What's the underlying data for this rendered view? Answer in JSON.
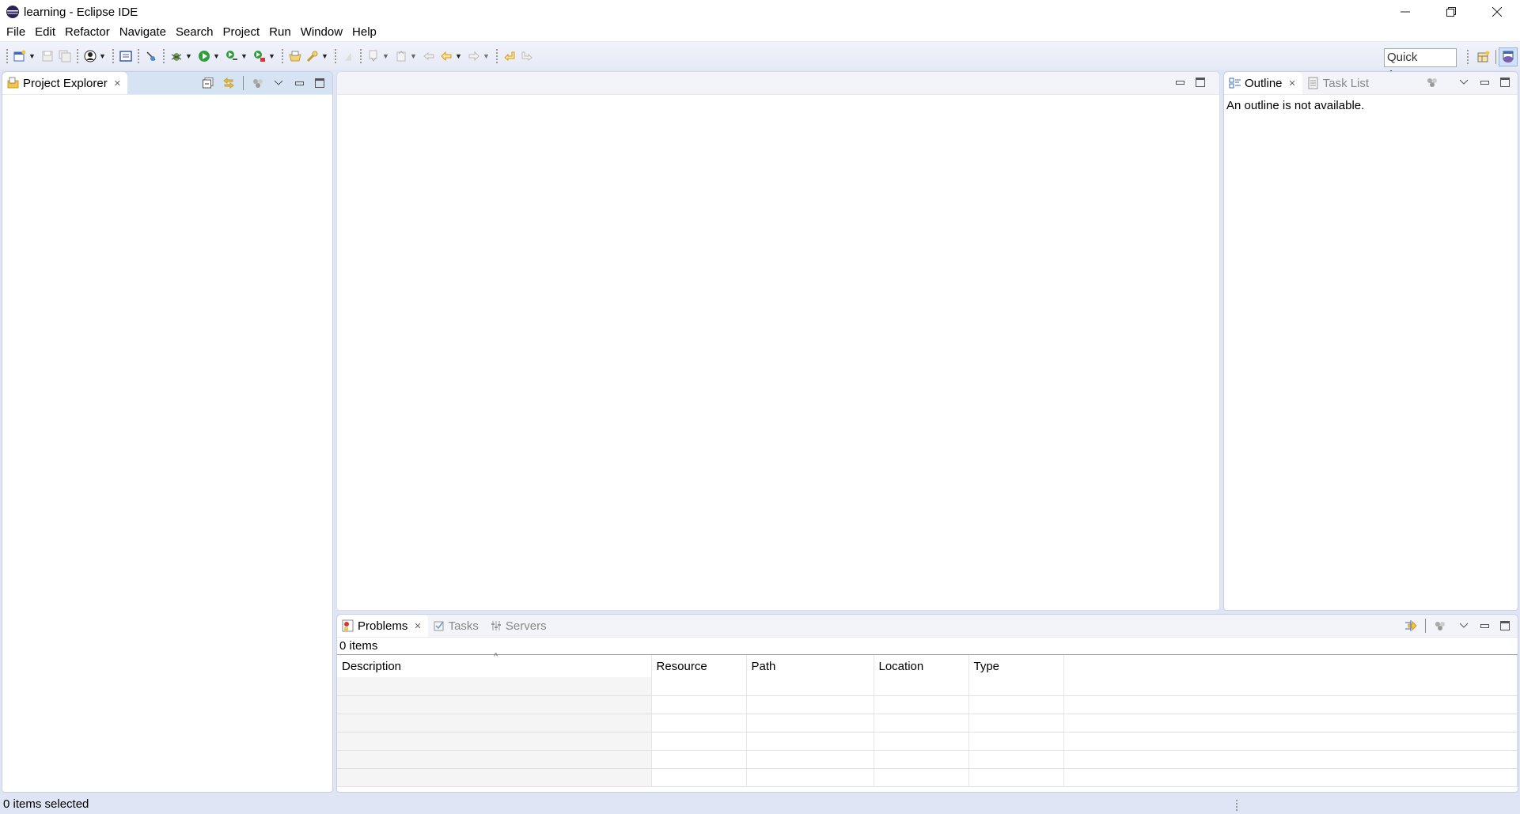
{
  "window": {
    "title": "learning - Eclipse IDE",
    "controls": [
      "minimize",
      "restore",
      "close"
    ]
  },
  "menubar": {
    "items": [
      "File",
      "Edit",
      "Refactor",
      "Navigate",
      "Search",
      "Project",
      "Run",
      "Window",
      "Help"
    ]
  },
  "toolbar": {
    "quick_access": "Quick Access",
    "icons": [
      "new-wizard",
      "save",
      "save-all",
      "java-ee-perspective",
      "open-console",
      "skip-breakpoints",
      "debug",
      "run",
      "run-coverage",
      "external-tools",
      "open-type",
      "search",
      "next-annotation",
      "previous-annotation",
      "last-edit-location",
      "back",
      "forward",
      "pin-editor",
      "unpin"
    ]
  },
  "project_explorer": {
    "tab_label": "Project Explorer",
    "items": []
  },
  "editor": {
    "empty": true
  },
  "outline": {
    "tabs": [
      {
        "label": "Outline",
        "selected": true
      },
      {
        "label": "Task List",
        "selected": false
      }
    ],
    "message": "An outline is not available."
  },
  "problems": {
    "tabs": [
      {
        "label": "Problems",
        "selected": true
      },
      {
        "label": "Tasks",
        "selected": false
      },
      {
        "label": "Servers",
        "selected": false
      }
    ],
    "count_label": "0 items",
    "columns": [
      "Description",
      "Resource",
      "Path",
      "Location",
      "Type"
    ],
    "sort_indicator": "^",
    "rows": []
  },
  "statusbar": {
    "text": "0 items selected"
  }
}
